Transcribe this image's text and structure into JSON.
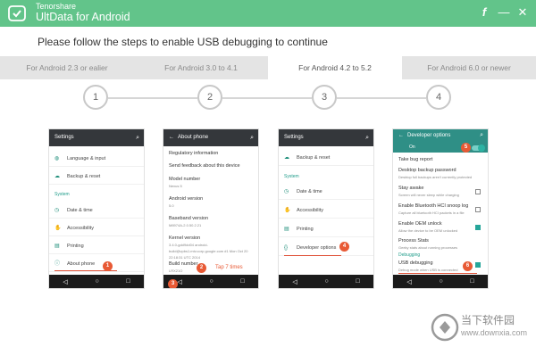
{
  "window": {
    "vendor": "Tenorshare",
    "product": "UltData for Android",
    "icons": [
      "feedback-icon",
      "minimize-icon",
      "close-icon"
    ]
  },
  "instruction": "Please follow the steps to enable USB debugging to continue",
  "tabs": [
    {
      "label": "For Android 2.3 or ealier",
      "active": false
    },
    {
      "label": "For Android 3.0 to 4.1",
      "active": false
    },
    {
      "label": "For Android 4.2 to 5.2",
      "active": true
    },
    {
      "label": "For Android 6.0 or newer",
      "active": false
    }
  ],
  "steps": [
    "1",
    "2",
    "3",
    "4"
  ],
  "phones": {
    "p1": {
      "title": "Settings",
      "items": [
        {
          "label": "Language & input",
          "icon": "globe-icon"
        },
        {
          "label": "Backup & reset",
          "icon": "cloud-icon"
        },
        {
          "label": "System",
          "section": true
        },
        {
          "label": "Date & time",
          "icon": "clock-icon"
        },
        {
          "label": "Accessibility",
          "icon": "accessibility-icon"
        },
        {
          "label": "Printing",
          "icon": "print-icon"
        },
        {
          "label": "About phone",
          "icon": "info-icon"
        }
      ],
      "badge": "1"
    },
    "p2": {
      "title": "About phone",
      "items": [
        {
          "key": "Regulatory information",
          "val": ""
        },
        {
          "key": "Send feedback about this device",
          "val": ""
        },
        {
          "key": "Model number",
          "val": "Nexus 5"
        },
        {
          "key": "Android version",
          "val": "5.0"
        },
        {
          "key": "Baseband version",
          "val": "M8974A-2.0.50.2.21"
        },
        {
          "key": "Kernel version",
          "val": "3.4.0-gdd9dd04 android-build@vpbs1.mtv.corp.google.com #1 Mon Oct 20 22:18:31 UTC 2014"
        },
        {
          "key": "Build number",
          "val": "LRX21O"
        }
      ],
      "badges": [
        "2",
        "3"
      ],
      "tap": "Tap 7 times"
    },
    "p3": {
      "title": "Settings",
      "items": [
        {
          "label": "Backup & reset",
          "icon": "cloud-icon"
        },
        {
          "label": "System",
          "section": true
        },
        {
          "label": "Date & time",
          "icon": "clock-icon"
        },
        {
          "label": "Accessibility",
          "icon": "accessibility-icon"
        },
        {
          "label": "Printing",
          "icon": "print-icon"
        },
        {
          "label": "Developer options",
          "icon": "braces-icon"
        }
      ],
      "badge": "4"
    },
    "p4": {
      "title": "Developer options",
      "toggle_label": "On",
      "items": [
        {
          "key": "Take bug report",
          "val": "",
          "check": null
        },
        {
          "key": "Desktop backup password",
          "val": "Desktop full backups aren't currently protected",
          "check": null
        },
        {
          "key": "Stay awake",
          "val": "Screen will never sleep while charging",
          "check": false
        },
        {
          "key": "Enable Bluetooth HCI snoop log",
          "val": "Capture all bluetooth HCI packets in a file",
          "check": false
        },
        {
          "key": "Enable OEM unlock",
          "val": "Allow the device to be OEM unlocked",
          "check": true
        },
        {
          "key": "Process Stats",
          "val": "Geeky stats about running processes",
          "check": null
        }
      ],
      "section": "Debugging",
      "usb_title": "USB debugging",
      "usb_sub": "Debug mode when USB is connected",
      "badges": [
        "5",
        "6"
      ]
    }
  },
  "watermark": {
    "text": "当下软件园",
    "url": "www.downxia.com"
  }
}
